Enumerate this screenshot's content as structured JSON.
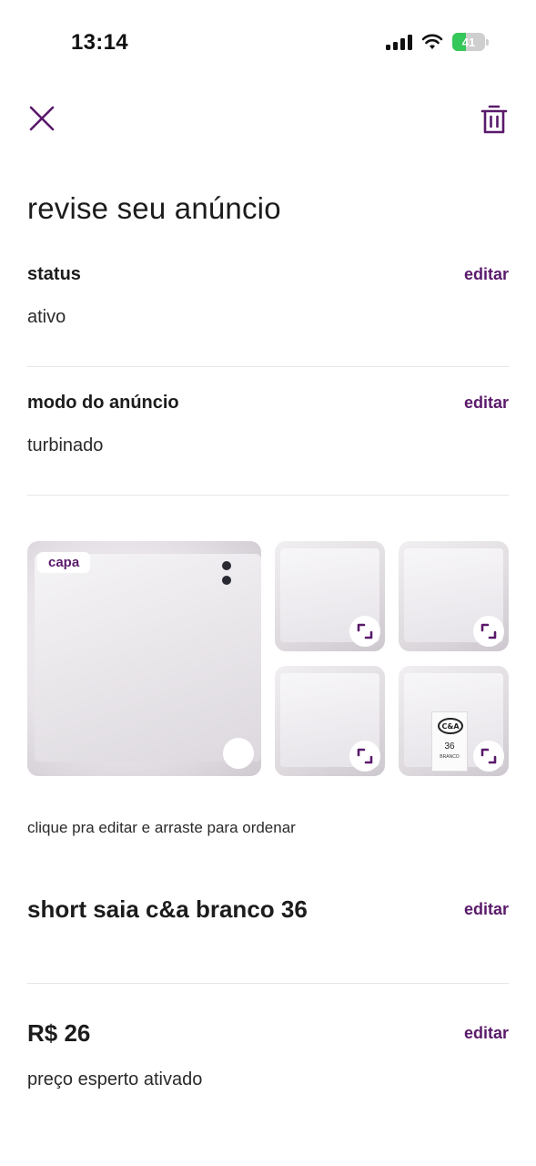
{
  "status_bar": {
    "time": "13:14",
    "battery_level": "41",
    "icons": [
      "signal-icon",
      "wifi-icon",
      "battery-icon"
    ]
  },
  "header": {
    "close_icon": "close-icon",
    "delete_icon": "trash-icon"
  },
  "page_title": "revise seu anúncio",
  "status_section": {
    "label": "status",
    "value": "ativo",
    "edit_label": "editar"
  },
  "mode_section": {
    "label": "modo do anúncio",
    "value": "turbinado",
    "edit_label": "editar"
  },
  "photos": {
    "cover_label": "capa",
    "hint": "clique pra editar e arraste para ordenar",
    "tag_brand": "C&A",
    "tag_size": "36",
    "tag_color": "BRANCO"
  },
  "product": {
    "title": "short saia c&a branco 36",
    "edit_label": "editar"
  },
  "price": {
    "value": "R$ 26",
    "note": "preço esperto ativado",
    "edit_label": "editar"
  },
  "colors": {
    "accent": "#5a1a6b",
    "battery": "#34c759"
  }
}
